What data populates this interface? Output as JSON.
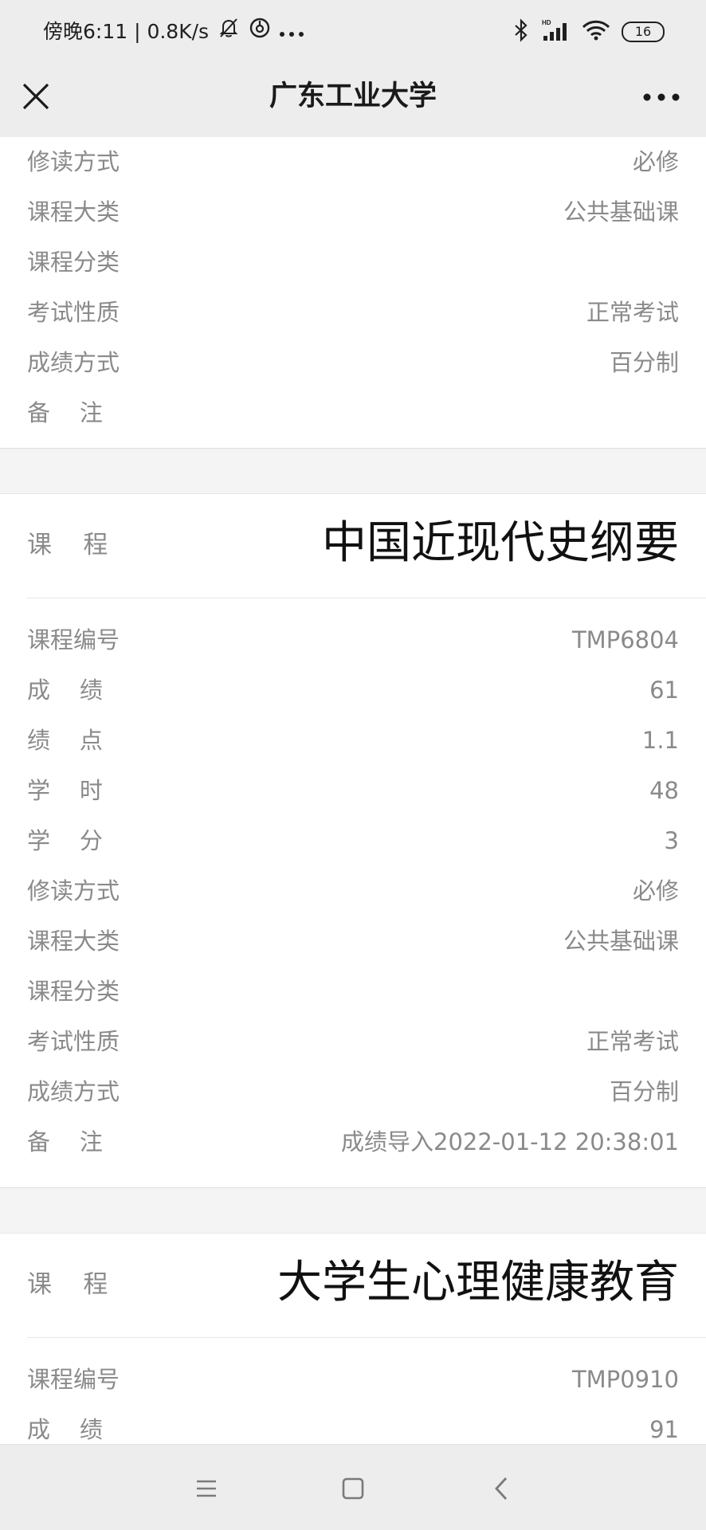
{
  "status_bar": {
    "time_speed": "傍晚6:11 | 0.8K/s",
    "battery_level": "16"
  },
  "nav": {
    "title": "广东工业大学"
  },
  "partial_course": {
    "rows": [
      {
        "label": "修读方式",
        "value": "必修"
      },
      {
        "label": "课程大类",
        "value": "公共基础课"
      },
      {
        "label": "课程分类",
        "value": ""
      },
      {
        "label": "考试性质",
        "value": "正常考试"
      },
      {
        "label": "成绩方式",
        "value": "百分制"
      },
      {
        "label": "备    注",
        "value": ""
      }
    ]
  },
  "courses": [
    {
      "label": "课    程",
      "name": "中国近现代史纲要",
      "rows": [
        {
          "label": "课程编号",
          "value": "TMP6804"
        },
        {
          "label": "成    绩",
          "value": "61"
        },
        {
          "label": "绩    点",
          "value": "1.1"
        },
        {
          "label": "学    时",
          "value": "48"
        },
        {
          "label": "学    分",
          "value": "3"
        },
        {
          "label": "修读方式",
          "value": "必修"
        },
        {
          "label": "课程大类",
          "value": "公共基础课"
        },
        {
          "label": "课程分类",
          "value": ""
        },
        {
          "label": "考试性质",
          "value": "正常考试"
        },
        {
          "label": "成绩方式",
          "value": "百分制"
        },
        {
          "label": "备    注",
          "value": "成绩导入2022-01-12 20:38:01"
        }
      ]
    },
    {
      "label": "课    程",
      "name": "大学生心理健康教育",
      "rows": [
        {
          "label": "课程编号",
          "value": "TMP0910"
        },
        {
          "label": "成    绩",
          "value": "91"
        }
      ]
    }
  ]
}
